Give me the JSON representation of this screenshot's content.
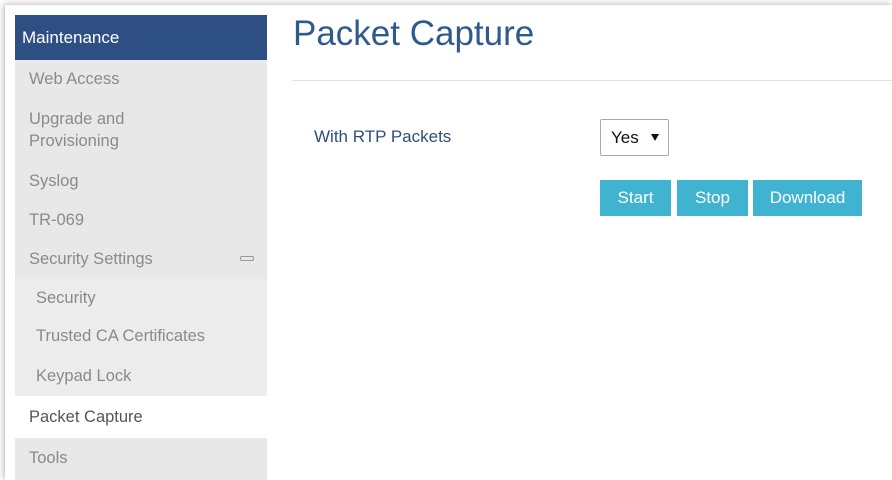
{
  "sidebar": {
    "header": "Maintenance",
    "items": [
      {
        "label": "Web Access"
      },
      {
        "label": "Upgrade and\nProvisioning"
      },
      {
        "label": "Syslog"
      },
      {
        "label": "TR-069"
      },
      {
        "label": "Security Settings"
      },
      {
        "label": "Security"
      },
      {
        "label": "Trusted CA Certificates"
      },
      {
        "label": "Keypad Lock"
      },
      {
        "label": "Packet Capture"
      },
      {
        "label": "Tools"
      }
    ]
  },
  "main": {
    "title": "Packet Capture",
    "rtp_label": "With RTP Packets",
    "rtp_select": {
      "value": "Yes"
    },
    "buttons": {
      "start": "Start",
      "stop": "Stop",
      "download": "Download"
    }
  },
  "colors": {
    "header_bg": "#2e4f83",
    "button_bg": "#3fb3d0",
    "title": "#2e5a8e"
  }
}
